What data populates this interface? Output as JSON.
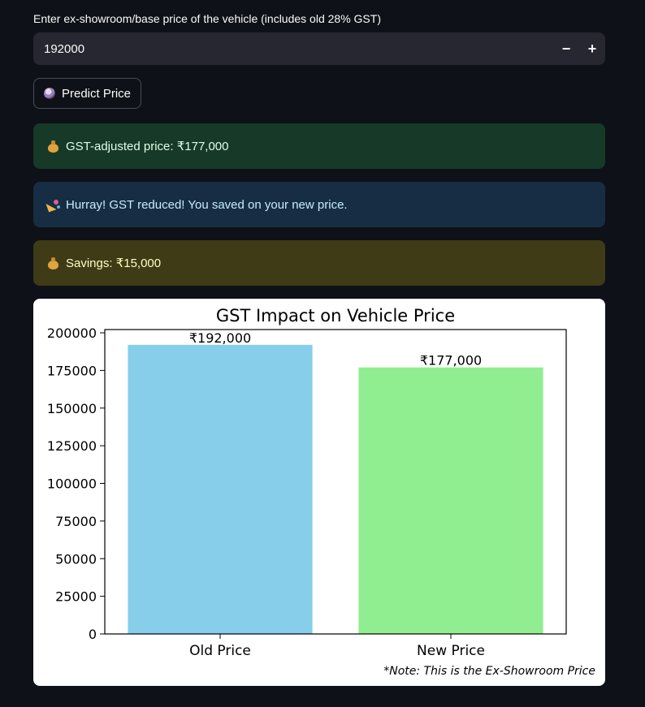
{
  "price_input": {
    "label": "Enter ex-showroom/base price of the vehicle (includes old 28% GST)",
    "value": "192000",
    "minus": "−",
    "plus": "+"
  },
  "predict_button": {
    "label": "Predict Price",
    "icon": "crystal-ball-icon"
  },
  "alerts": {
    "success": {
      "icon": "moneybag-icon",
      "text": "GST-adjusted price: ₹177,000",
      "color": "#173928"
    },
    "info": {
      "icon": "party-popper-icon",
      "text": "Hurray! GST reduced! You saved on your new price.",
      "color": "#172d43"
    },
    "warning": {
      "icon": "moneybag-icon",
      "text": "Savings: ₹15,000",
      "color": "#3e3b16"
    }
  },
  "chart_data": {
    "type": "bar",
    "title": "GST Impact on Vehicle Price",
    "xlabel": "",
    "ylabel": "",
    "categories": [
      "Old Price",
      "New Price"
    ],
    "values": [
      192000,
      177000
    ],
    "value_labels": [
      "₹192,000",
      "₹177,000"
    ],
    "colors": [
      "#87ceeb",
      "#90ee90"
    ],
    "ylim": [
      0,
      200000
    ],
    "yticks": [
      0,
      25000,
      50000,
      75000,
      100000,
      125000,
      150000,
      175000,
      200000
    ],
    "grid": false,
    "note": "*Note: This is the Ex-Showroom Price"
  }
}
